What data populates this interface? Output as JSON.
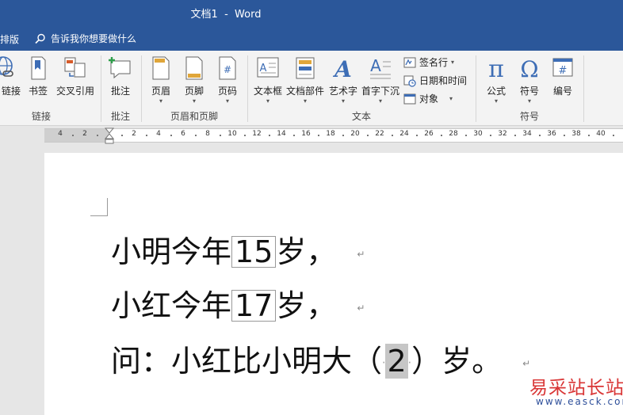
{
  "title": {
    "doc": "文档1",
    "sep": "-",
    "app": "Word"
  },
  "menu": {
    "partial_tab": "排版",
    "tell_me": "告诉我你想要做什么"
  },
  "ribbon": {
    "links_group": {
      "label": "链接",
      "btn_link": "链接",
      "btn_bookmark": "书签",
      "btn_crossref": "交叉引用"
    },
    "comments_group": {
      "label": "批注",
      "btn_comment": "批注"
    },
    "headerfooter_group": {
      "label": "页眉和页脚",
      "btn_header": "页眉",
      "btn_footer": "页脚",
      "btn_pagenum": "页码"
    },
    "text_group": {
      "label": "文本",
      "btn_textbox": "文本框",
      "btn_parts": "文档部件",
      "btn_wordart": "艺术字",
      "btn_dropcap": "首字下沉",
      "btn_signature": "签名行",
      "btn_datetime": "日期和时间",
      "btn_object": "对象"
    },
    "symbols_group": {
      "label": "符号",
      "btn_equation": "公式",
      "btn_symbol": "符号",
      "btn_number": "编号"
    }
  },
  "ruler": {
    "left_numbers": [
      "4",
      "2"
    ],
    "numbers": [
      "2",
      "4",
      "6",
      "8",
      "10",
      "12",
      "14",
      "16",
      "18",
      "20",
      "22",
      "24",
      "26",
      "28",
      "30",
      "32",
      "34",
      "36",
      "38",
      "40"
    ]
  },
  "document": {
    "line1": {
      "before": "小明今年",
      "value": "15",
      "after": "岁，"
    },
    "line2": {
      "before": "小红今年",
      "value": "17",
      "after": "岁，"
    },
    "line3": {
      "before": "问：小红比小明大（",
      "value": "2",
      "after": "）岁。"
    },
    "para_mark": "↵"
  },
  "watermark": {
    "text": "易采站长站",
    "url": "www.easck.com"
  }
}
